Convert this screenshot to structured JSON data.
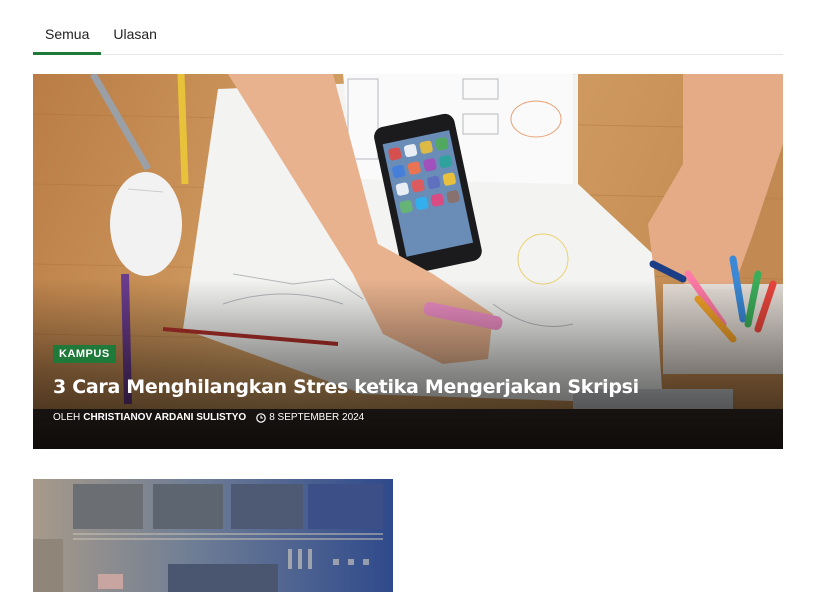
{
  "tabs": [
    {
      "label": "Semua",
      "active": true
    },
    {
      "label": "Ulasan",
      "active": false
    }
  ],
  "featured": {
    "category": "KAMPUS",
    "title": "3 Cara Menghilangkan Stres ketika Mengerjakan Skripsi",
    "byline_prefix": "OLEH",
    "author": "CHRISTIANOV ARDANI SULISTYO",
    "date": "8 SEPTEMBER 2024"
  },
  "colors": {
    "accent": "#1f7a3a"
  }
}
